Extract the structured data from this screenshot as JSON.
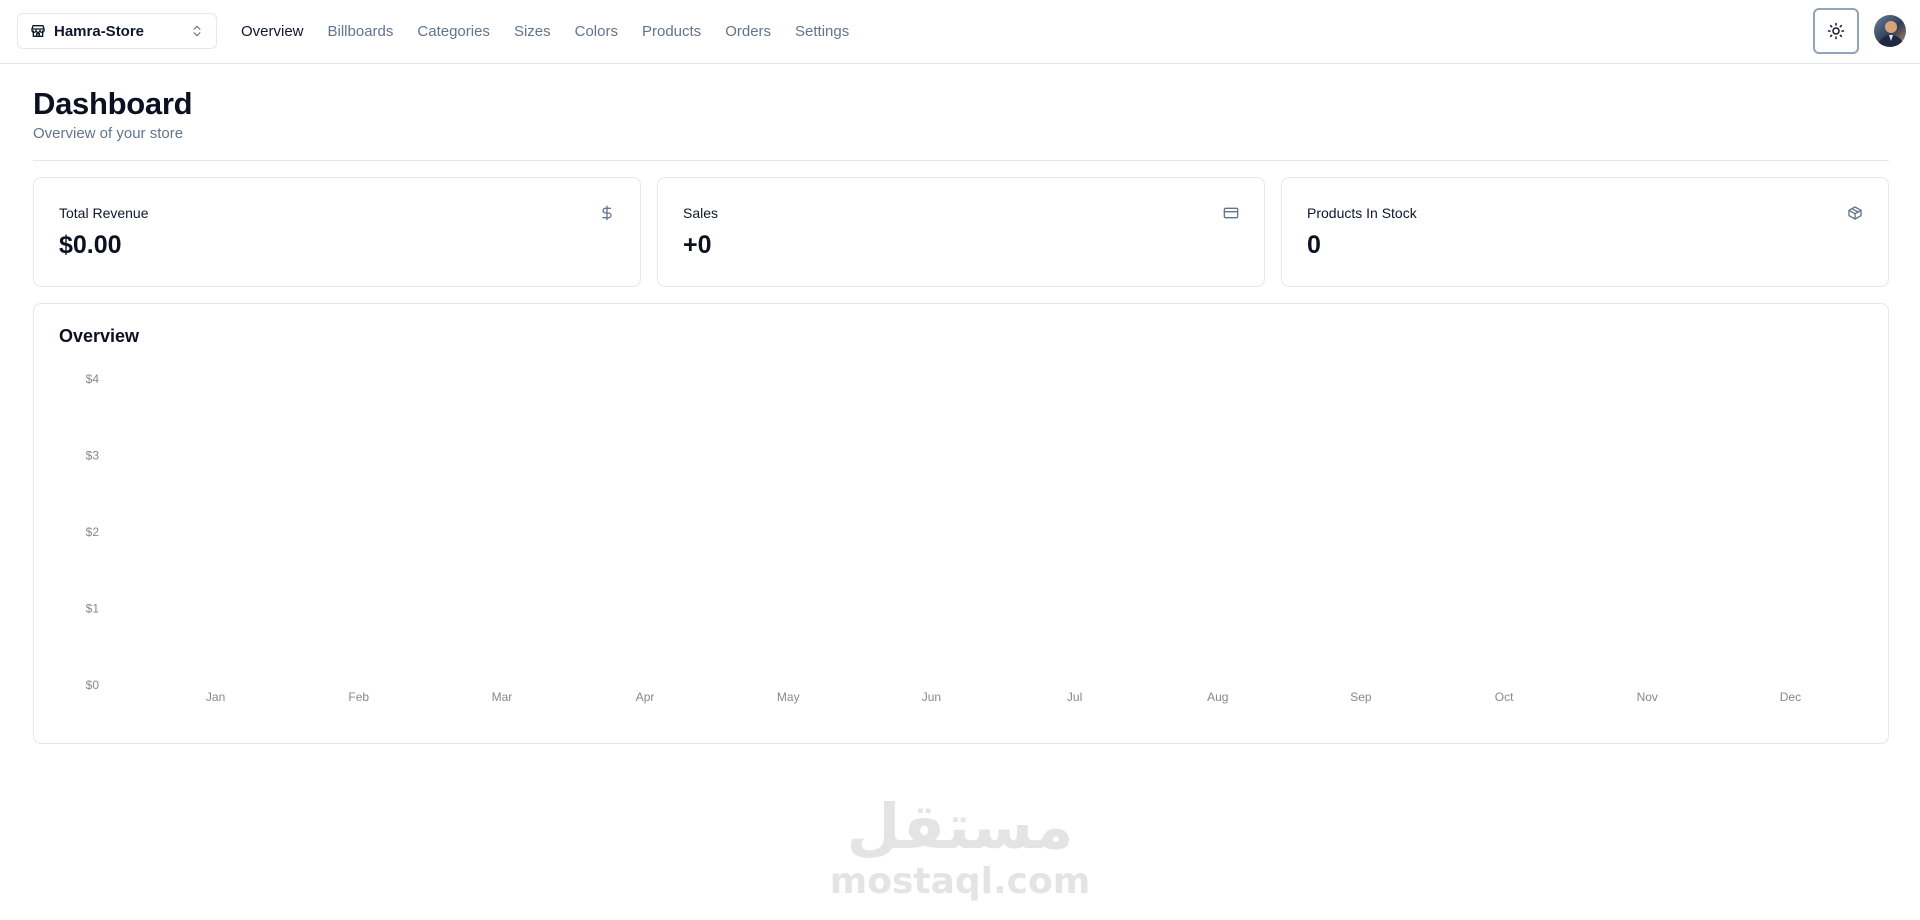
{
  "header": {
    "store_name": "Hamra-Store",
    "store_icon": "store-icon",
    "nav": [
      {
        "label": "Overview",
        "active": true
      },
      {
        "label": "Billboards",
        "active": false
      },
      {
        "label": "Categories",
        "active": false
      },
      {
        "label": "Sizes",
        "active": false
      },
      {
        "label": "Colors",
        "active": false
      },
      {
        "label": "Products",
        "active": false
      },
      {
        "label": "Orders",
        "active": false
      },
      {
        "label": "Settings",
        "active": false
      }
    ],
    "theme_icon": "sun-icon"
  },
  "page": {
    "title": "Dashboard",
    "subtitle": "Overview of your store"
  },
  "stats": [
    {
      "label": "Total Revenue",
      "value": "$0.00",
      "icon": "dollar-icon"
    },
    {
      "label": "Sales",
      "value": "+0",
      "icon": "credit-card-icon"
    },
    {
      "label": "Products In Stock",
      "value": "0",
      "icon": "package-icon"
    }
  ],
  "overview": {
    "title": "Overview"
  },
  "chart_data": {
    "type": "bar",
    "categories": [
      "Jan",
      "Feb",
      "Mar",
      "Apr",
      "May",
      "Jun",
      "Jul",
      "Aug",
      "Sep",
      "Oct",
      "Nov",
      "Dec"
    ],
    "values": [
      0,
      0,
      0,
      0,
      0,
      0,
      0,
      0,
      0,
      0,
      0,
      0
    ],
    "y_ticks": [
      "$0",
      "$1",
      "$2",
      "$3",
      "$4"
    ],
    "ylim": [
      0,
      4
    ],
    "grid": false,
    "bar_color": "#adfa1d"
  },
  "watermark": {
    "arabic": "مستقل",
    "latin": "mostaql.com"
  },
  "colors": {
    "text": "#0f172a",
    "muted": "#64748b",
    "border": "#e5e7eb"
  }
}
